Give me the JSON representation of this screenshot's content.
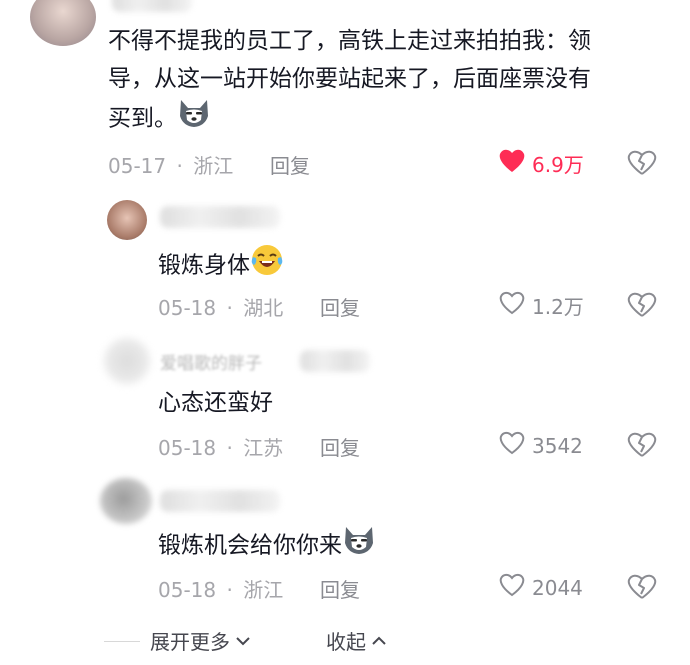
{
  "comments": [
    {
      "text_line1": "不得不提我的员工了，高铁上走过来拍拍我：领",
      "text_line2": "导，从这一站开始你要站起来了，后面座票没有",
      "text_line3": "买到。",
      "emoji": "husky-emoji",
      "date": "05-17",
      "separator": "·",
      "location": "浙江",
      "reply_label": "回复",
      "likes": "6.9万",
      "liked": true
    },
    {
      "text": "锻炼身体",
      "emoji": "laughing-crying-emoji",
      "date": "05-18",
      "separator": "·",
      "location": "湖北",
      "reply_label": "回复",
      "likes": "1.2万",
      "liked": false
    },
    {
      "username": "爱唱歌的胖子",
      "text": "心态还蛮好",
      "date": "05-18",
      "separator": "·",
      "location": "江苏",
      "reply_label": "回复",
      "likes": "3542",
      "liked": false
    },
    {
      "text": "锻炼机会给你你来",
      "emoji": "husky-emoji",
      "date": "05-18",
      "separator": "·",
      "location": "浙江",
      "reply_label": "回复",
      "likes": "2044",
      "liked": false
    }
  ],
  "footer": {
    "expand_label": "展开更多",
    "collapse_label": "收起"
  },
  "colors": {
    "like_red": "#fe2c55",
    "meta_gray": "#a6a6ab",
    "text": "#161823"
  }
}
